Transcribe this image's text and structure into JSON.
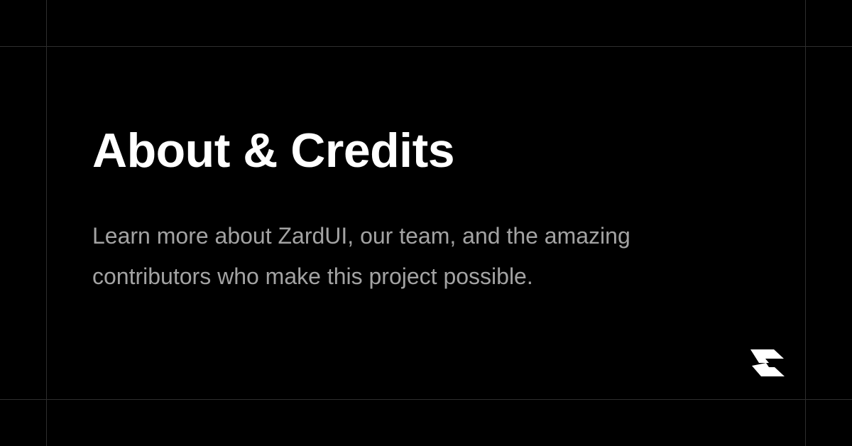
{
  "page": {
    "title": "About & Credits",
    "description": "Learn more about ZardUI, our team, and the amazing contributors who make this project possible."
  },
  "logo": {
    "icon": "zardui-logo-icon"
  },
  "colors": {
    "background": "#000000",
    "title": "#ffffff",
    "description": "#a3a3a3",
    "grid_line": "#2e2e2e",
    "logo": "#ffffff"
  }
}
